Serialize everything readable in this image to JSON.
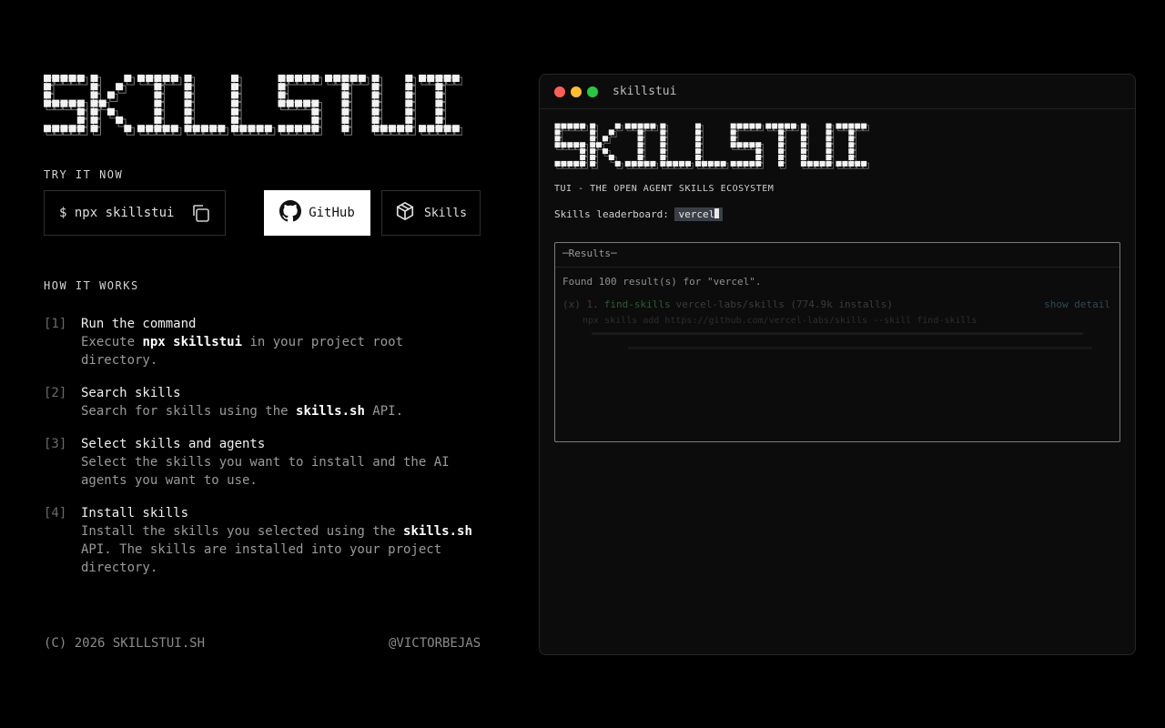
{
  "brand": {
    "logo_text": "SKILLSTUI"
  },
  "try": {
    "label": "TRY IT NOW",
    "command": "$ npx skillstui",
    "github_label": "GitHub",
    "skills_label": "Skills"
  },
  "how": {
    "label": "HOW IT WORKS",
    "steps": [
      {
        "num": "[1]",
        "title": "Run the command",
        "desc_pre": "Execute ",
        "desc_bold": "npx skillstui",
        "desc_post": " in your project root directory."
      },
      {
        "num": "[2]",
        "title": "Search skills",
        "desc_pre": "Search for skills using the ",
        "desc_bold": "skills.sh",
        "desc_post": " API."
      },
      {
        "num": "[3]",
        "title": "Select skills and agents",
        "desc": "Select the skills you want to install and the AI agents you want to use."
      },
      {
        "num": "[4]",
        "title": "Install skills",
        "desc_pre": "Install the skills you selected using the ",
        "desc_bold": "skills.sh",
        "desc_post": " API. The skills are installed into your project directory."
      }
    ]
  },
  "footer": {
    "copyright": "(C) 2026 SKILLSTUI.SH",
    "author": "@VICTORBEJAS"
  },
  "terminal": {
    "window_title": "skillstui",
    "tagline": "TUI - THE OPEN AGENT SKILLS ECOSYSTEM",
    "leaderboard_label": "Skills leaderboard: ",
    "query": "vercel",
    "results_title": "─Results─",
    "found_text": "Found 100 result(s) for \"vercel\".",
    "result_marker": "(x) 1.",
    "result_name": "find-skills",
    "result_repo": "vercel-labs/skills (774.9k installs)",
    "result_action": "show detail",
    "result_command": "npx skills add https://github.com/vercel-labs/skills --skill find-skills"
  },
  "colors": {
    "accent_green": "#28c840",
    "accent_red": "#ff5f57",
    "accent_yellow": "#febc2e",
    "background": "#000000"
  }
}
